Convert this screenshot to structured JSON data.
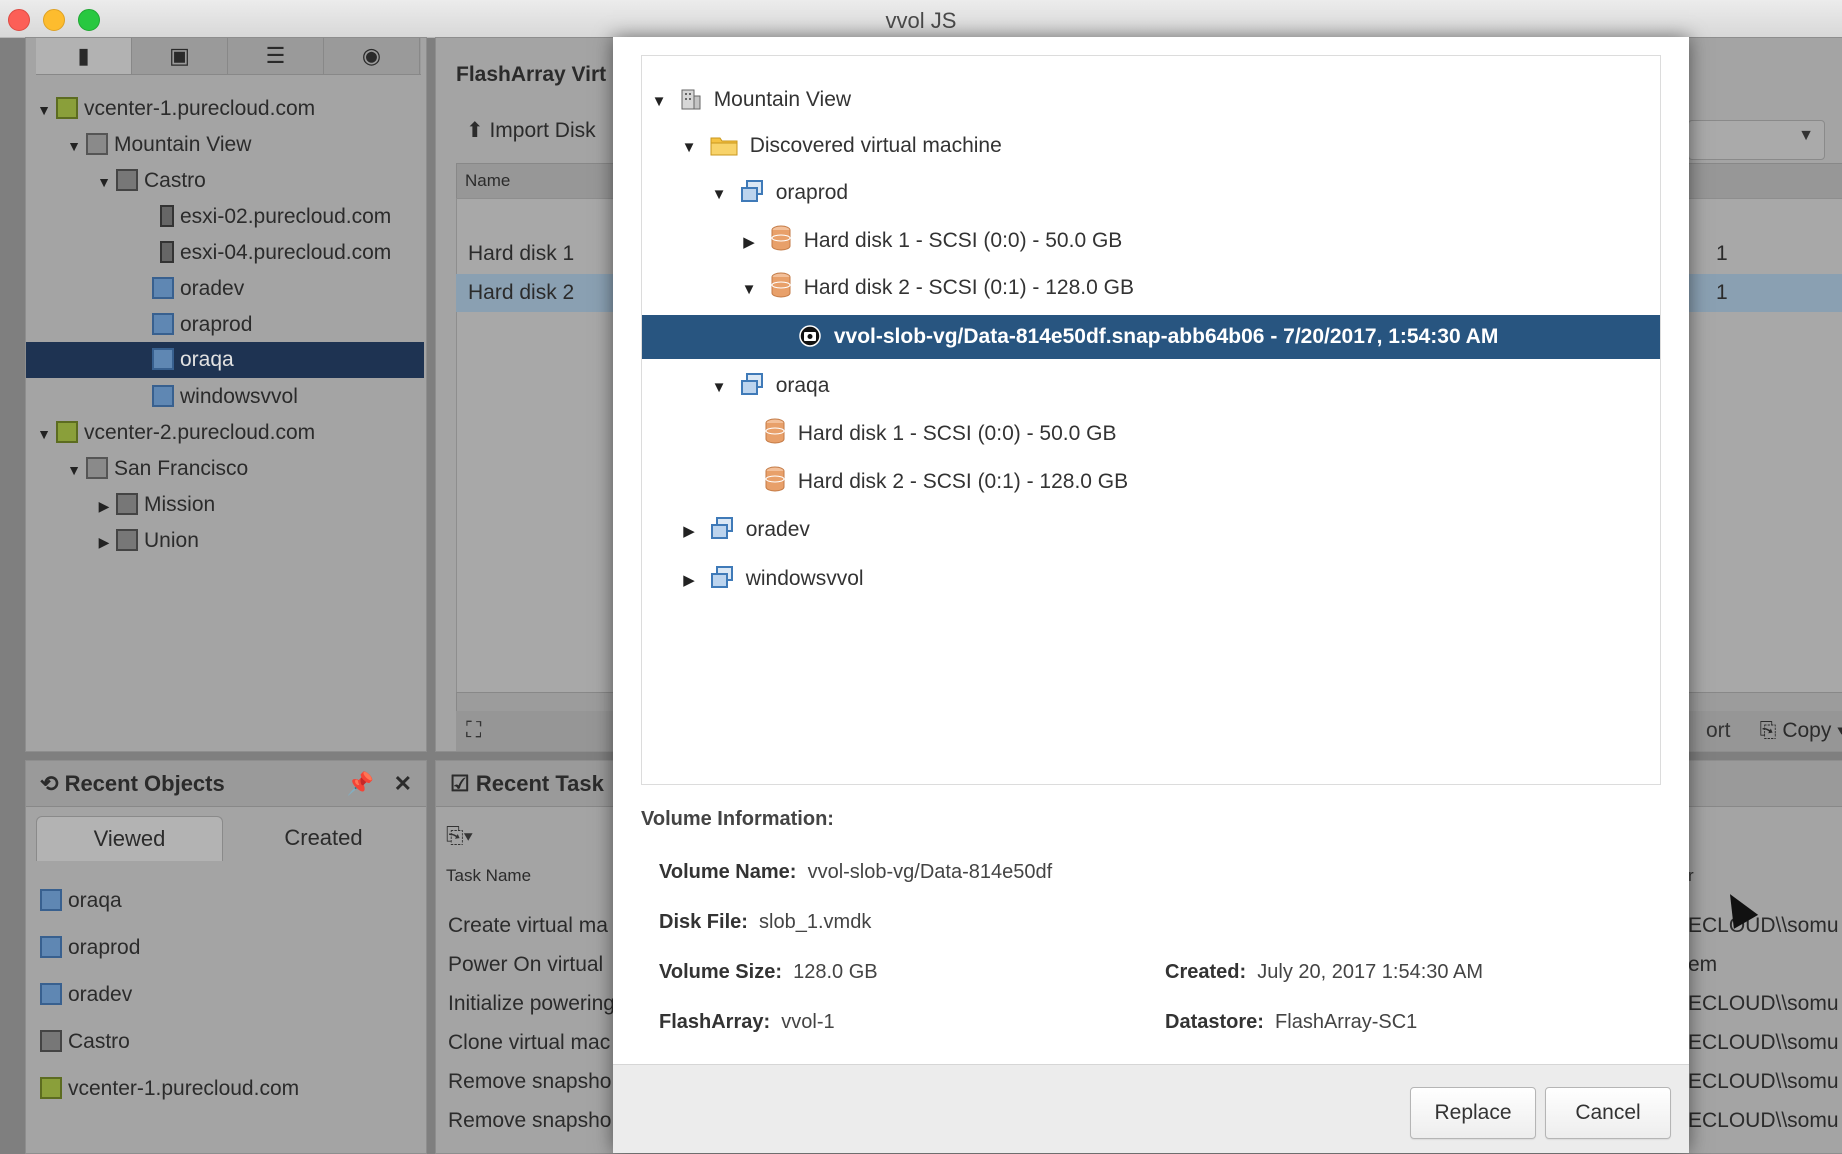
{
  "window": {
    "title": "vvol JS"
  },
  "navigator": {
    "tree": [
      {
        "label": "vcenter-1.purecloud.com"
      },
      {
        "label": "Mountain View"
      },
      {
        "label": "Castro"
      },
      {
        "label": "esxi-02.purecloud.com"
      },
      {
        "label": "esxi-04.purecloud.com"
      },
      {
        "label": "oradev"
      },
      {
        "label": "oraprod"
      },
      {
        "label": "oraqa"
      },
      {
        "label": "windowsvvol"
      },
      {
        "label": "vcenter-2.purecloud.com"
      },
      {
        "label": "San Francisco"
      },
      {
        "label": "Mission"
      },
      {
        "label": "Union"
      }
    ]
  },
  "main": {
    "title": "FlashArray Virt",
    "import_label": "Import Disk",
    "column_name": "Name",
    "rows": [
      {
        "name": "Hard disk 1",
        "tail": "1"
      },
      {
        "name": "Hard disk 2",
        "tail": "1"
      }
    ],
    "bottom_left_label": "ort",
    "copy_label": "Copy"
  },
  "recent_objects": {
    "title": "Recent Objects",
    "tabs": {
      "viewed": "Viewed",
      "created": "Created"
    },
    "items": [
      {
        "label": "oraqa"
      },
      {
        "label": "oraprod"
      },
      {
        "label": "oradev"
      },
      {
        "label": "Castro"
      },
      {
        "label": "vcenter-1.purecloud.com"
      }
    ]
  },
  "recent_tasks": {
    "title": "Recent Task",
    "column_task": "Task Name",
    "column_initiator_tail": "r",
    "rows": [
      {
        "task": "Create virtual ma",
        "initiator": "ECLOUD\\\\somu"
      },
      {
        "task": "Power On virtual",
        "initiator": "em"
      },
      {
        "task": "Initialize powering",
        "initiator": "ECLOUD\\\\somu"
      },
      {
        "task": "Clone virtual mac",
        "initiator": "ECLOUD\\\\somu"
      },
      {
        "task": "Remove snapsho",
        "initiator": "ECLOUD\\\\somu"
      },
      {
        "task": "Remove snapsho",
        "initiator": "ECLOUD\\\\somu"
      }
    ]
  },
  "dialog": {
    "tree": {
      "datacenter": "Mountain View",
      "folder": "Discovered virtual machine",
      "vm1": "oraprod",
      "vm1_disk1": "Hard disk 1 - SCSI (0:0) - 50.0 GB",
      "vm1_disk2": "Hard disk 2 - SCSI (0:1) - 128.0 GB",
      "snapshot": "vvol-slob-vg/Data-814e50df.snap-abb64b06 - 7/20/2017, 1:54:30 AM",
      "vm2": "oraqa",
      "vm2_disk1": "Hard disk 1 - SCSI (0:0) - 50.0 GB",
      "vm2_disk2": "Hard disk 2 - SCSI (0:1) - 128.0 GB",
      "vm3": "oradev",
      "vm4": "windowsvvol"
    },
    "info": {
      "title": "Volume Information:",
      "volume_name_label": "Volume Name:",
      "volume_name": "vvol-slob-vg/Data-814e50df",
      "disk_file_label": "Disk File:",
      "disk_file": "slob_1.vmdk",
      "volume_size_label": "Volume Size:",
      "volume_size": "128.0 GB",
      "created_label": "Created:",
      "created": "July 20, 2017 1:54:30 AM",
      "flasharray_label": "FlashArray:",
      "flasharray": "vvol-1",
      "datastore_label": "Datastore:",
      "datastore": "FlashArray-SC1"
    },
    "buttons": {
      "replace": "Replace",
      "cancel": "Cancel"
    }
  },
  "colors": {
    "selection": "#285580",
    "accent_vm": "#5f87b3",
    "disk": "#e8a06a"
  }
}
